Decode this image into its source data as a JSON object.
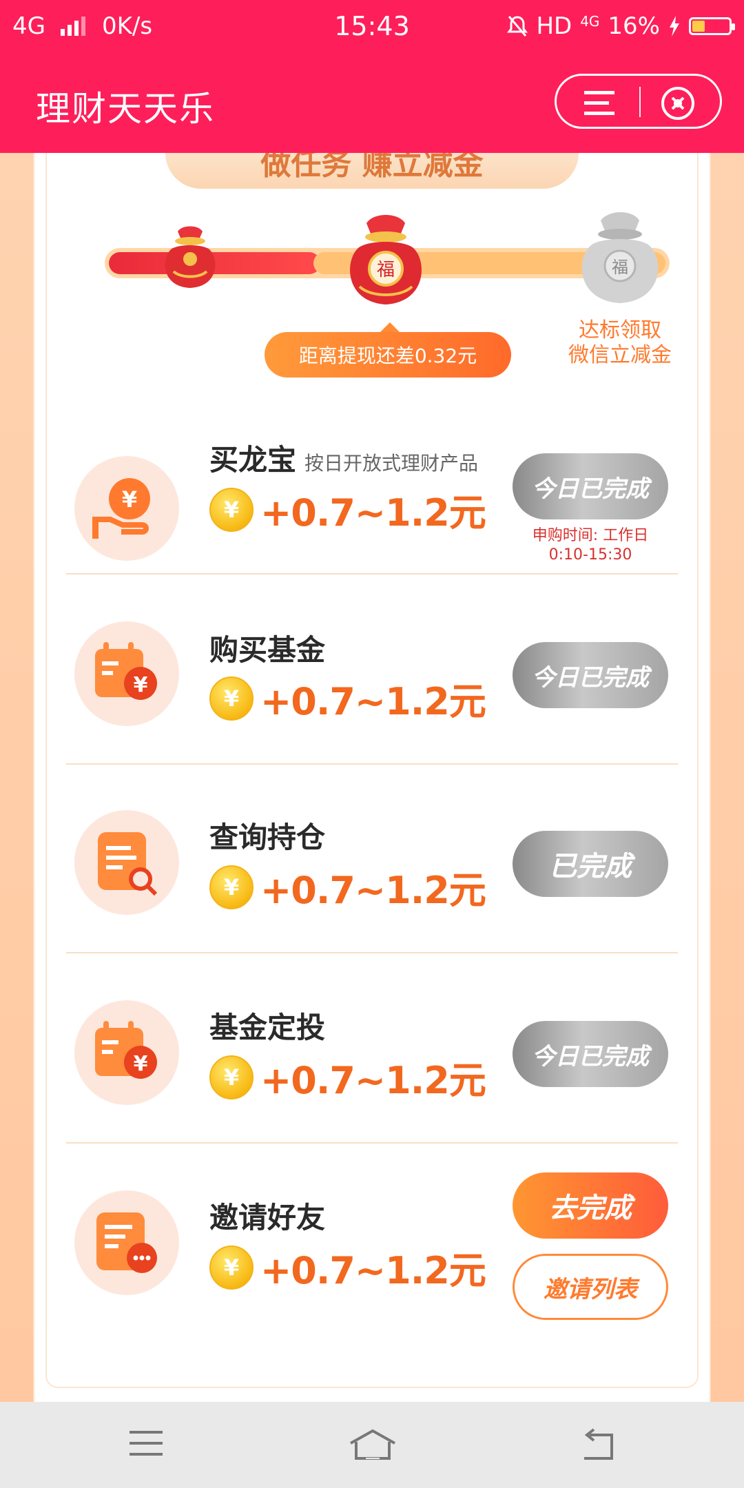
{
  "status_bar": {
    "network": "4G",
    "speed": "0K/s",
    "time": "15:43",
    "hd": "HD",
    "net_type": "4G",
    "battery": "16%"
  },
  "header": {
    "title": "理财天天乐"
  },
  "banner": {
    "title": "做任务 赚立减金"
  },
  "progress": {
    "tip": "距离提现还差0.32元",
    "goal_line1": "达标领取",
    "goal_line2": "微信立减金",
    "fraction": 0.38
  },
  "tasks": [
    {
      "name": "买龙宝",
      "sub": "按日开放式理财产品",
      "reward": "+0.7~1.2元",
      "button": "今日已完成",
      "note": "申购时间: 工作日 0:10-15:30",
      "icon": "coin-hand-icon"
    },
    {
      "name": "购买基金",
      "reward": "+0.7~1.2元",
      "button": "今日已完成",
      "icon": "calendar-yen-icon"
    },
    {
      "name": "查询持仓",
      "reward": "+0.7~1.2元",
      "button": "已完成",
      "icon": "document-search-icon"
    },
    {
      "name": "基金定投",
      "reward": "+0.7~1.2元",
      "button": "今日已完成",
      "icon": "calendar-yen-icon"
    },
    {
      "name": "邀请好友",
      "reward": "+0.7~1.2元",
      "button": "去完成",
      "button2": "邀请列表",
      "icon": "document-chat-icon"
    }
  ],
  "coin_symbol": "¥",
  "colors": {
    "header": "#fe1f5a",
    "accent": "#f2681f",
    "button_orange": "#ff7a2e"
  }
}
